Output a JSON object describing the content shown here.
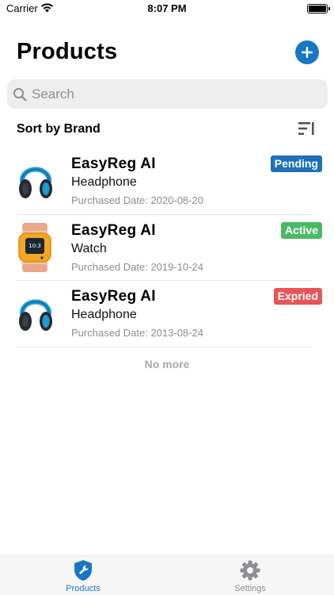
{
  "status_bar": {
    "carrier": "Carrier",
    "time": "8:07 PM"
  },
  "header": {
    "title": "Products",
    "add_icon": "plus-circle-icon"
  },
  "search": {
    "placeholder": "Search",
    "value": ""
  },
  "sort": {
    "label": "Sort by Brand",
    "icon": "sort-icon"
  },
  "colors": {
    "accent": "#1877c5",
    "pending": "#1d70b9",
    "active": "#4ab965",
    "expired": "#ea5455"
  },
  "products": [
    {
      "name": "EasyReg AI",
      "type": "Headphone",
      "date": "Purchased Date: 2020-08-20",
      "status": "Pending",
      "image": "headphone"
    },
    {
      "name": "EasyReg AI",
      "type": "Watch",
      "date": "Purchased Date: 2019-10-24",
      "status": "Active",
      "image": "watch"
    },
    {
      "name": "EasyReg AI",
      "type": "Headphone",
      "date": "Purchased Date: 2013-08-24",
      "status": "Expried",
      "image": "headphone"
    }
  ],
  "list_footer": "No more",
  "tab_bar": {
    "products": {
      "label": "Products",
      "icon": "shield-wrench-icon"
    },
    "settings": {
      "label": "Settings",
      "icon": "gear-icon"
    }
  }
}
